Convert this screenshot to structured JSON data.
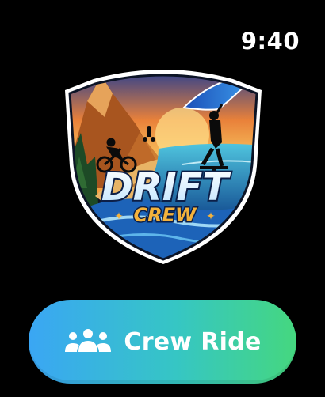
{
  "status": {
    "time": "9:40"
  },
  "logo": {
    "line1": "DRIFT",
    "line2": "CREW"
  },
  "action": {
    "label": "Crew Ride",
    "icon": "people-group-icon"
  },
  "colors": {
    "background": "#000000",
    "button_start": "#3aa6f4",
    "button_end": "#45d77f",
    "text": "#ffffff"
  }
}
